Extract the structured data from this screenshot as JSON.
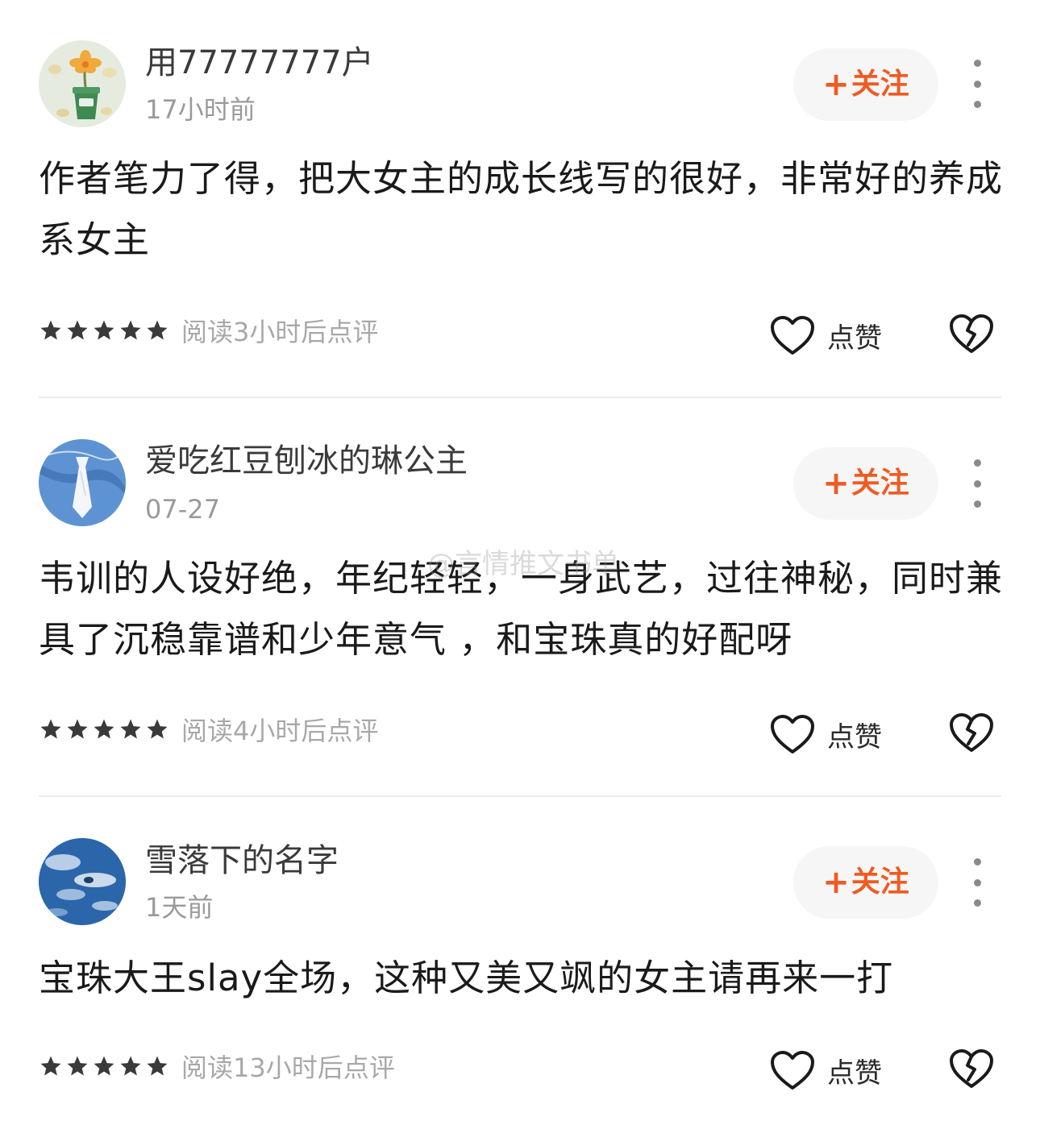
{
  "reviews": [
    {
      "username": "用77777777户",
      "time": "17小时前",
      "follow_label": "关注",
      "text": "作者笔力了得，把大女主的成长线写的很好，非常好的养成系女主",
      "read_note": "阅读3小时后点评",
      "stars": 5,
      "like_label": "点赞",
      "avatar_icon": "flower-pot-avatar"
    },
    {
      "username": "爱吃红豆刨冰的琳公主",
      "time": "07-27",
      "follow_label": "关注",
      "text": "韦训的人设好绝，年纪轻轻，一身武艺，过往神秘，同时兼具了沉稳靠谱和少年意气 ，和宝珠真的好配呀",
      "read_note": "阅读4小时后点评",
      "stars": 5,
      "like_label": "点赞",
      "avatar_icon": "tie-avatar"
    },
    {
      "username": "雪落下的名字",
      "time": "1天前",
      "follow_label": "关注",
      "text": "宝珠大王slay全场，这种又美又飒的女主请再来一打",
      "read_note": "阅读13小时后点评",
      "stars": 5,
      "like_label": "点赞",
      "avatar_icon": "ocean-avatar"
    }
  ],
  "watermark": "@言情推文书单",
  "colors": {
    "accent": "#f15a22",
    "follow_bg": "#f6f6f6",
    "muted": "#9a9a9a",
    "divider": "#ececec"
  }
}
